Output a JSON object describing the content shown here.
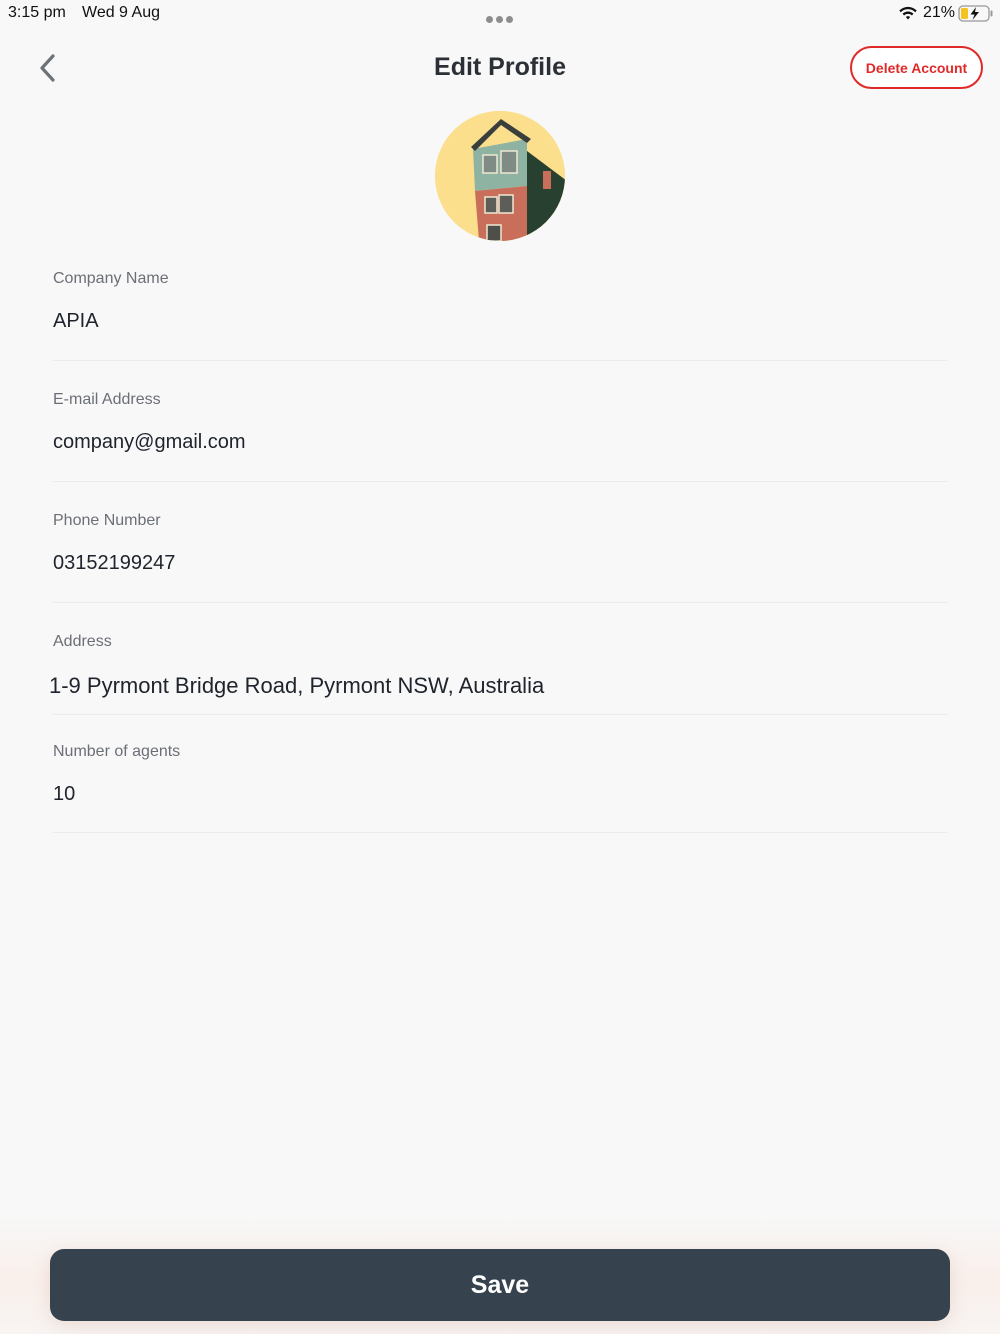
{
  "status_bar": {
    "time": "3:15 pm",
    "date": "Wed 9 Aug",
    "battery": "21%",
    "wifi_icon": "wifi-icon",
    "battery_icon": "battery-charging-icon"
  },
  "header": {
    "title": "Edit Profile",
    "back_icon": "chevron-left-icon",
    "delete_label": "Delete Account",
    "delete_color": "#e02a2a"
  },
  "avatar": {
    "icon": "building-photo"
  },
  "form": {
    "company_name": {
      "label": "Company Name",
      "value": "APIA"
    },
    "email": {
      "label": "E-mail Address",
      "value": "company@gmail.com"
    },
    "phone": {
      "label": "Phone Number",
      "value": "03152199247"
    },
    "address": {
      "label": "Address",
      "value": "1-9 Pyrmont Bridge Road, Pyrmont NSW, Australia"
    },
    "agents": {
      "label": "Number of agents",
      "value": "10"
    }
  },
  "footer": {
    "save_label": "Save",
    "save_color": "#36424d"
  }
}
